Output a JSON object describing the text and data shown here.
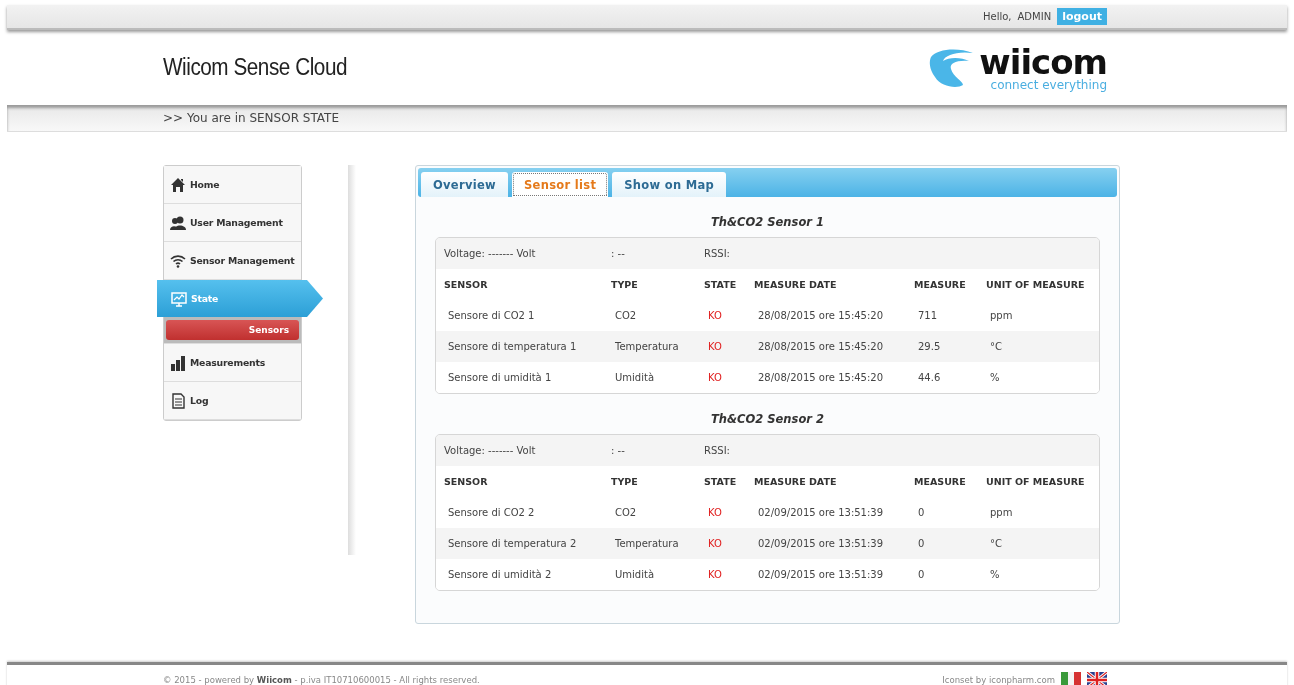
{
  "top_bar": {
    "greeting": "Hello,",
    "user": "ADMIN",
    "logout": "logout"
  },
  "header": {
    "title": "Wiicom Sense Cloud",
    "logo_name": "wiicom",
    "logo_tagline": "connect everything"
  },
  "breadcrumb": ">> You are in SENSOR STATE",
  "sidebar": {
    "items": [
      {
        "label": "Home",
        "selected": false
      },
      {
        "label": "User Management",
        "selected": false
      },
      {
        "label": "Sensor Management",
        "selected": false
      },
      {
        "label": "State",
        "selected": true,
        "children": [
          {
            "label": "Sensors",
            "selected": true
          }
        ]
      },
      {
        "label": "Measurements",
        "selected": false
      },
      {
        "label": "Log",
        "selected": false
      }
    ]
  },
  "tabs": [
    {
      "label": "Overview",
      "selected": false
    },
    {
      "label": "Sensor list",
      "selected": true
    },
    {
      "label": "Show on Map",
      "selected": false
    }
  ],
  "groups": [
    {
      "title": "Th&CO2 Sensor 1",
      "voltage": "Voltage: ------- Volt",
      "info": ": --",
      "rssi": "RSSI:",
      "columns": [
        "SENSOR",
        "TYPE",
        "STATE",
        "MEASURE DATE",
        "MEASURE",
        "UNIT OF MEASURE"
      ],
      "rows": [
        [
          "Sensore di CO2 1",
          "CO2",
          "KO",
          "28/08/2015 ore 15:45:20",
          "711",
          "ppm"
        ],
        [
          "Sensore di temperatura 1",
          "Temperatura",
          "KO",
          "28/08/2015 ore 15:45:20",
          "29.5",
          "°C"
        ],
        [
          "Sensore di umidità 1",
          "Umidità",
          "KO",
          "28/08/2015 ore 15:45:20",
          "44.6",
          "%"
        ]
      ]
    },
    {
      "title": "Th&CO2 Sensor 2",
      "voltage": "Voltage: ------- Volt",
      "info": ": --",
      "rssi": "RSSI:",
      "columns": [
        "SENSOR",
        "TYPE",
        "STATE",
        "MEASURE DATE",
        "MEASURE",
        "UNIT OF MEASURE"
      ],
      "rows": [
        [
          "Sensore di CO2 2",
          "CO2",
          "KO",
          "02/09/2015 ore 13:51:39",
          "0",
          "ppm"
        ],
        [
          "Sensore di temperatura 2",
          "Temperatura",
          "KO",
          "02/09/2015 ore 13:51:39",
          "0",
          "°C"
        ],
        [
          "Sensore di umidità 2",
          "Umidità",
          "KO",
          "02/09/2015 ore 13:51:39",
          "0",
          "%"
        ]
      ]
    }
  ],
  "footer": {
    "copyright": "© 2015 - powered by **Wiicom** - p.iva IT10710600015 - All rights reserved.",
    "iconset": "Iconset by iconpharm.com"
  }
}
